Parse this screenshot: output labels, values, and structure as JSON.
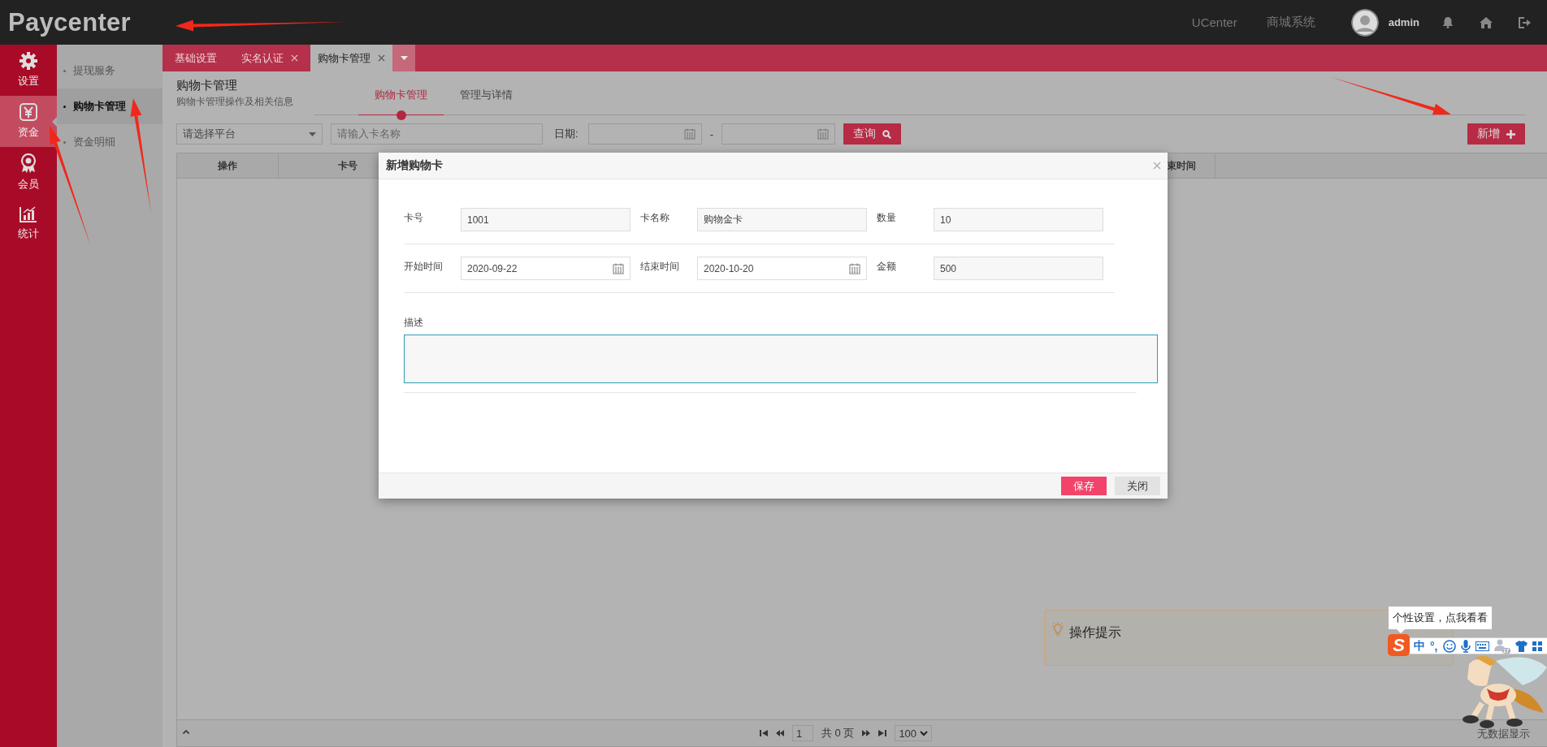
{
  "header": {
    "logo": "Paycenter",
    "links": [
      "UCenter",
      "商城系统"
    ],
    "user": "admin"
  },
  "nav": {
    "items": [
      {
        "label": "设置",
        "kind": "gear",
        "selected": false
      },
      {
        "label": "资金",
        "kind": "yen",
        "selected": true
      },
      {
        "label": "会员",
        "kind": "award",
        "selected": false
      },
      {
        "label": "统计",
        "kind": "chart",
        "selected": false
      }
    ]
  },
  "subnav": {
    "items": [
      {
        "label": "提现服务",
        "selected": false
      },
      {
        "label": "购物卡管理",
        "selected": true
      },
      {
        "label": "资金明细",
        "selected": false
      }
    ]
  },
  "tabs": [
    {
      "label": "基础设置",
      "closable": false,
      "selected": false
    },
    {
      "label": "实名认证",
      "closable": true,
      "selected": false
    },
    {
      "label": "购物卡管理",
      "closable": true,
      "selected": true
    }
  ],
  "page": {
    "title": "购物卡管理",
    "subtitle": "购物卡管理操作及相关信息",
    "subtabs": [
      {
        "label": "购物卡管理",
        "selected": true
      },
      {
        "label": "管理与详情",
        "selected": false
      }
    ]
  },
  "filters": {
    "platform_placeholder": "请选择平台",
    "name_placeholder": "请输入卡名称",
    "date_label": "日期:",
    "date_separator": "-",
    "search_button": "查询",
    "add_button": "新增"
  },
  "table": {
    "columns": [
      "操作",
      "卡号",
      "束时间"
    ]
  },
  "pager": {
    "page": "1",
    "total": "共 0 页",
    "page_size": "100",
    "empty_text": "无数据显示"
  },
  "modal": {
    "title": "新增购物卡",
    "rows": [
      [
        {
          "label": "卡号",
          "value": "1001",
          "kind": "text"
        },
        {
          "label": "卡名称",
          "value": "购物金卡",
          "kind": "text"
        },
        {
          "label": "数量",
          "value": "10",
          "kind": "text"
        }
      ],
      [
        {
          "label": "开始时间",
          "value": "2020-09-22",
          "kind": "date"
        },
        {
          "label": "结束时间",
          "value": "2020-10-20",
          "kind": "date"
        },
        {
          "label": "金额",
          "value": "500",
          "kind": "text"
        }
      ]
    ],
    "description_label": "描述",
    "buttons": [
      {
        "label": "保存",
        "kind": "primary"
      },
      {
        "label": "关闭",
        "kind": "default"
      }
    ]
  },
  "tips": {
    "title": "操作提示"
  },
  "ime": {
    "tooltip": "个性设置，点我看看",
    "logo": "S",
    "mode": "中",
    "punct": "°,",
    "badge": "17"
  }
}
